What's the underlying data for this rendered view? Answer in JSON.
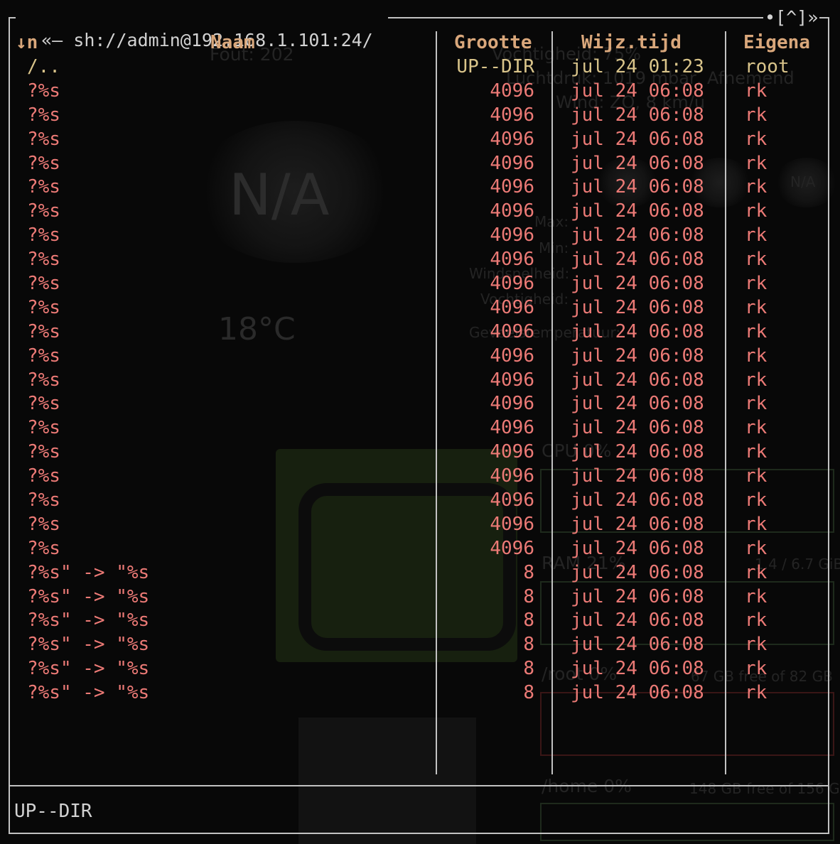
{
  "window": {
    "path_title": "sh://admin@192.168.1.101:24/",
    "title_left_glyph": "«—",
    "title_right_glyph": "•[^]»"
  },
  "columns": {
    "sort_indicator": "↓n",
    "name": "Naam",
    "size": "Grootte",
    "mtime": "Wijz.tijd",
    "owner": "Eigena"
  },
  "parent_row": {
    "name": "/..",
    "size": "UP--DIR",
    "mtime": "jul 24 01:23",
    "owner": "root"
  },
  "rows": [
    {
      "name": "?%s",
      "size": "4096",
      "mtime": "jul 24 06:08",
      "owner": "rk"
    },
    {
      "name": "?%s",
      "size": "4096",
      "mtime": "jul 24 06:08",
      "owner": "rk"
    },
    {
      "name": "?%s",
      "size": "4096",
      "mtime": "jul 24 06:08",
      "owner": "rk"
    },
    {
      "name": "?%s",
      "size": "4096",
      "mtime": "jul 24 06:08",
      "owner": "rk"
    },
    {
      "name": "?%s",
      "size": "4096",
      "mtime": "jul 24 06:08",
      "owner": "rk"
    },
    {
      "name": "?%s",
      "size": "4096",
      "mtime": "jul 24 06:08",
      "owner": "rk"
    },
    {
      "name": "?%s",
      "size": "4096",
      "mtime": "jul 24 06:08",
      "owner": "rk"
    },
    {
      "name": "?%s",
      "size": "4096",
      "mtime": "jul 24 06:08",
      "owner": "rk"
    },
    {
      "name": "?%s",
      "size": "4096",
      "mtime": "jul 24 06:08",
      "owner": "rk"
    },
    {
      "name": "?%s",
      "size": "4096",
      "mtime": "jul 24 06:08",
      "owner": "rk"
    },
    {
      "name": "?%s",
      "size": "4096",
      "mtime": "jul 24 06:08",
      "owner": "rk"
    },
    {
      "name": "?%s",
      "size": "4096",
      "mtime": "jul 24 06:08",
      "owner": "rk"
    },
    {
      "name": "?%s",
      "size": "4096",
      "mtime": "jul 24 06:08",
      "owner": "rk"
    },
    {
      "name": "?%s",
      "size": "4096",
      "mtime": "jul 24 06:08",
      "owner": "rk"
    },
    {
      "name": "?%s",
      "size": "4096",
      "mtime": "jul 24 06:08",
      "owner": "rk"
    },
    {
      "name": "?%s",
      "size": "4096",
      "mtime": "jul 24 06:08",
      "owner": "rk"
    },
    {
      "name": "?%s",
      "size": "4096",
      "mtime": "jul 24 06:08",
      "owner": "rk"
    },
    {
      "name": "?%s",
      "size": "4096",
      "mtime": "jul 24 06:08",
      "owner": "rk"
    },
    {
      "name": "?%s",
      "size": "4096",
      "mtime": "jul 24 06:08",
      "owner": "rk"
    },
    {
      "name": "?%s",
      "size": "4096",
      "mtime": "jul 24 06:08",
      "owner": "rk"
    },
    {
      "name": "?%s\" -> \"%s",
      "size": "8",
      "mtime": "jul 24 06:08",
      "owner": "rk"
    },
    {
      "name": "?%s\" -> \"%s",
      "size": "8",
      "mtime": "jul 24 06:08",
      "owner": "rk"
    },
    {
      "name": "?%s\" -> \"%s",
      "size": "8",
      "mtime": "jul 24 06:08",
      "owner": "rk"
    },
    {
      "name": "?%s\" -> \"%s",
      "size": "8",
      "mtime": "jul 24 06:08",
      "owner": "rk"
    },
    {
      "name": "?%s\" -> \"%s",
      "size": "8",
      "mtime": "jul 24 06:08",
      "owner": "rk"
    },
    {
      "name": "?%s\" -> \"%s",
      "size": "8",
      "mtime": "jul 24 06:08",
      "owner": "rk"
    }
  ],
  "status_line": "UP--DIR",
  "background": {
    "weather_error": "Fout: 202",
    "weather_na": "N/A",
    "weather_temp": "18°C",
    "humidity": "Vochtigheid: 75%",
    "pressure": "Luchtdruk: 1019 mbar, Afnemend",
    "wind": "Wind: ZO, 8 km/u",
    "forecast_na": "N/A",
    "max_label": "Max:",
    "min_label": "Min:",
    "windspeed_label": "Windsnelheid:",
    "humidity_label": "Vochtigheid:",
    "feels_label": "Gevoelstemperatuur:",
    "cpu_label": "CPU 0%",
    "ram_label": "RAM 21%",
    "ram_value": "1.4 / 6.7 GiB",
    "root_label": "/root 0%",
    "root_value": "67 GB free of 82 GB",
    "home_label": "/home 0%",
    "home_value": "148 GB free of 156 GB"
  },
  "colors": {
    "header": "#d9a77b",
    "updir": "#d9c48a",
    "file": "#ec7a76",
    "frame": "#c2c2c2",
    "background": "#080808"
  }
}
